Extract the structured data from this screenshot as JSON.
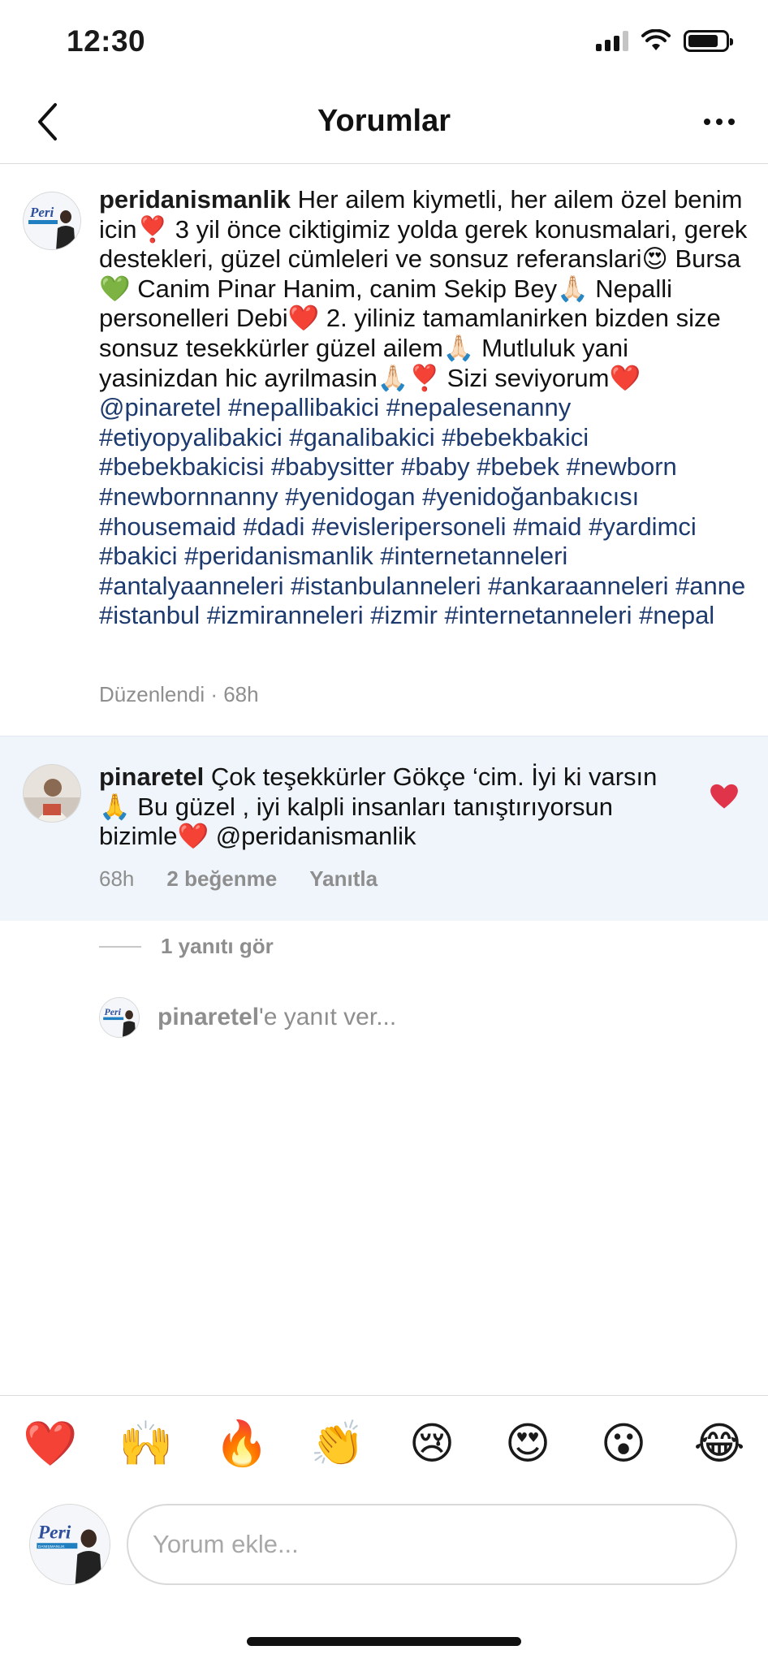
{
  "status_bar": {
    "time": "12:30"
  },
  "header": {
    "title": "Yorumlar"
  },
  "caption": {
    "username": "peridanismanlik",
    "text": "Her ailem kiymetli, her ailem özel benim icin❣️ 3 yil önce ciktigimiz yolda gerek konusmalari, gerek destekleri, güzel cümleleri ve sonsuz referanslari😍 Bursa💚 Canim Pinar Hanim, canim Sekip Bey🙏🏻 Nepalli personelleri Debi❤️ 2. yiliniz tamamlanirken bizden size sonsuz tesekkürler güzel ailem🙏🏻 Mutluluk yani yasinizdan hic ayrilmasin🙏🏻❣️ Sizi seviyorum❤️",
    "mentions_tags": "@pinaretel #nepallibakici #nepalesenanny #etiyopyalibakici #ganalibakici #bebekbakici #bebekbakicisi #babysitter #baby #bebek #newborn #newbornnanny #yenidogan #yenidoğanbakıcısı #housemaid #dadi #evisleripersoneli #maid #yardimci #bakici #peridanismanlik #internetanneleri #antalyaanneleri #istanbulanneleri #ankaraanneleri #anne #istanbul #izmiranneleri #izmir #internetanneleri #nepal",
    "meta": "Düzenlendi · 68h"
  },
  "reply": {
    "username": "pinaretel",
    "text": "Çok teşekkürler Gökçe ‘cim. İyi ki varsın🙏 Bu güzel , iyi kalpli insanları tanıştırıyorsun bizimle❤️",
    "mention": "@peridanismanlik",
    "time": "68h",
    "likes": "2 beğenme",
    "reply_label": "Yanıtla"
  },
  "view_replies": "1 yanıtı gör",
  "reply_to": {
    "username": "pinaretel",
    "suffix": "'e yanıt ver..."
  },
  "avatar_logo": {
    "brand": "Peri",
    "sub": "DANIŞMANLIK"
  },
  "emoji_bar": [
    "❤️",
    "🙌",
    "🔥",
    "👏",
    "😢",
    "😍",
    "😮",
    "😂"
  ],
  "composer": {
    "placeholder": "Yorum ekle..."
  },
  "colors": {
    "accent_tag": "#1d3a6e",
    "like_heart": "#e0344a",
    "reply_bg": "#eff5fb"
  }
}
